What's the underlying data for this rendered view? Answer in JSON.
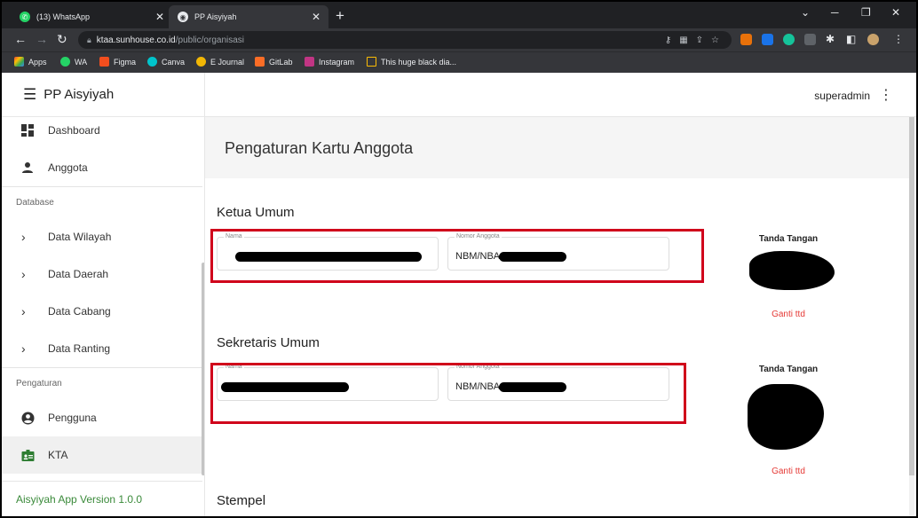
{
  "browser": {
    "tabs": [
      {
        "title": "(13) WhatsApp",
        "active": false
      },
      {
        "title": "PP Aisyiyah",
        "active": true
      }
    ],
    "url": {
      "host": "ktaa.sunhouse.co.id",
      "path": "/public/organisasi"
    },
    "bookmarks": [
      {
        "label": "Apps",
        "icon": "apps-grid-icon"
      },
      {
        "label": "WA",
        "icon": "whatsapp-icon"
      },
      {
        "label": "Figma",
        "icon": "figma-icon"
      },
      {
        "label": "Canva",
        "icon": "canva-icon"
      },
      {
        "label": "E Journal",
        "icon": "ejournal-icon"
      },
      {
        "label": "GitLab",
        "icon": "gitlab-icon"
      },
      {
        "label": "Instagram",
        "icon": "instagram-icon"
      },
      {
        "label": "This huge black dia...",
        "icon": "bookmark-note-icon"
      }
    ]
  },
  "sidebar": {
    "brand": "PP Aisyiyah",
    "items": [
      {
        "label": "Dashboard",
        "icon": "dashboard-icon"
      },
      {
        "label": "Anggota",
        "icon": "person-icon"
      }
    ],
    "section_database": "Database",
    "database_items": [
      {
        "label": "Data Wilayah"
      },
      {
        "label": "Data Daerah"
      },
      {
        "label": "Data Cabang"
      },
      {
        "label": "Data Ranting"
      }
    ],
    "section_pengaturan": "Pengaturan",
    "pengaturan_items": [
      {
        "label": "Pengguna",
        "icon": "account-circle-icon"
      },
      {
        "label": "KTA",
        "icon": "badge-icon",
        "active": true
      }
    ],
    "footer": "Aisyiyah App Version 1.0.0"
  },
  "topbar": {
    "user": "superadmin"
  },
  "page": {
    "title": "Pengaturan Kartu Anggota",
    "sections": [
      {
        "title": "Ketua Umum",
        "nama_label": "Nama",
        "nomor_label": "Nomor Anggota",
        "nomor_prefix": "NBM/NBA",
        "sig_title": "Tanda Tangan",
        "ganti": "Ganti ttd"
      },
      {
        "title": "Sekretaris Umum",
        "nama_label": "Nama",
        "nomor_label": "Nomor Anggota",
        "nomor_prefix": "NBM/NBA",
        "sig_title": "Tanda Tangan",
        "ganti": "Ganti ttd"
      },
      {
        "title": "Stempel"
      }
    ]
  },
  "colors": {
    "highlight": "#d0021b",
    "link": "#e53935",
    "footer": "#3a8a3a"
  }
}
